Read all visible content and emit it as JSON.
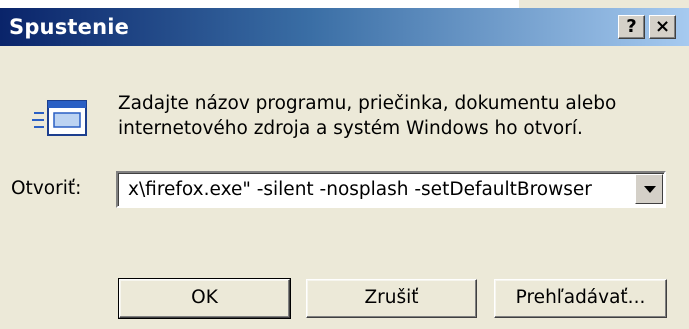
{
  "window": {
    "title": "Spustenie",
    "help_label": "?",
    "close_label": "×"
  },
  "description": {
    "line1": "Zadajte názov programu, priečinka, dokumentu alebo",
    "line2": "internetového zdroja a systém Windows ho otvorí."
  },
  "open": {
    "label": "Otvoriť:",
    "value": "x\\firefox.exe\" -silent -nosplash -setDefaultBrowser"
  },
  "buttons": {
    "ok": "OK",
    "cancel": "Zrušiť",
    "browse": "Prehľadávať..."
  },
  "icons": {
    "run": "run-program-icon",
    "dropdown": "chevron-down-icon"
  },
  "colors": {
    "title_start": "#0a246a",
    "title_end": "#a6caf0",
    "dialog_bg": "#ece9d8"
  }
}
